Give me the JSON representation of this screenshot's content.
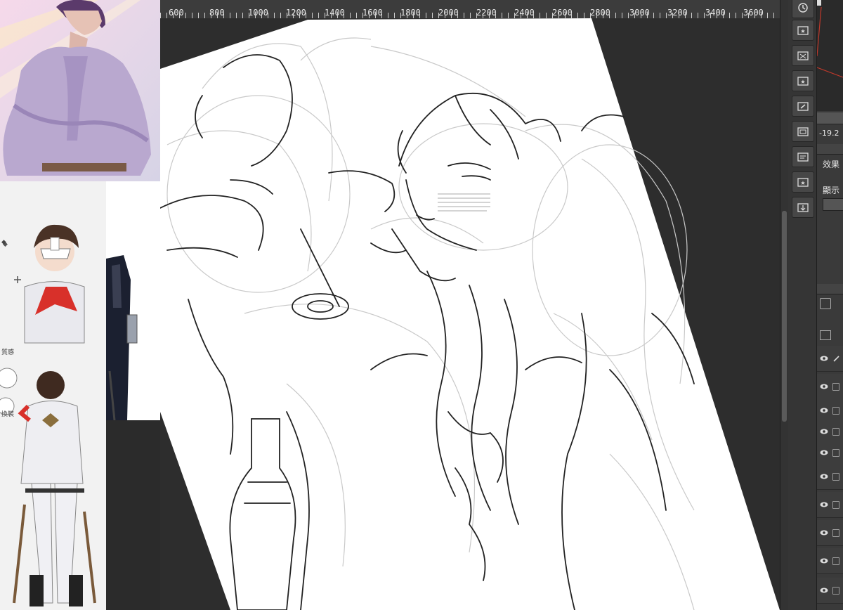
{
  "ruler": {
    "labels": [
      "600",
      "800",
      "1000",
      "1200",
      "1400",
      "1600",
      "1800",
      "2000",
      "2200",
      "2400",
      "2600",
      "2800",
      "3000",
      "3200",
      "3400",
      "3600"
    ]
  },
  "reference_panel": {
    "label_left_1": "◆",
    "label_left_2": "質感",
    "label_left_3": "換裝"
  },
  "tools": [
    {
      "icon": "navigator-icon"
    },
    {
      "icon": "star-folder-icon"
    },
    {
      "icon": "pattern-folder-icon"
    },
    {
      "icon": "star-folder-icon"
    },
    {
      "icon": "brush-folder-icon"
    },
    {
      "icon": "image-folder-icon"
    },
    {
      "icon": "layer-property-icon"
    },
    {
      "icon": "star-folder-icon"
    },
    {
      "icon": "download-folder-icon"
    }
  ],
  "right_panel": {
    "angle_value": "-19.2",
    "effect_label": "效果",
    "display_label": "顯示"
  },
  "colors": {
    "ui_dark": "#2b2b2b",
    "canvas_white": "#ffffff",
    "nav_red_line": "#c0392b"
  }
}
